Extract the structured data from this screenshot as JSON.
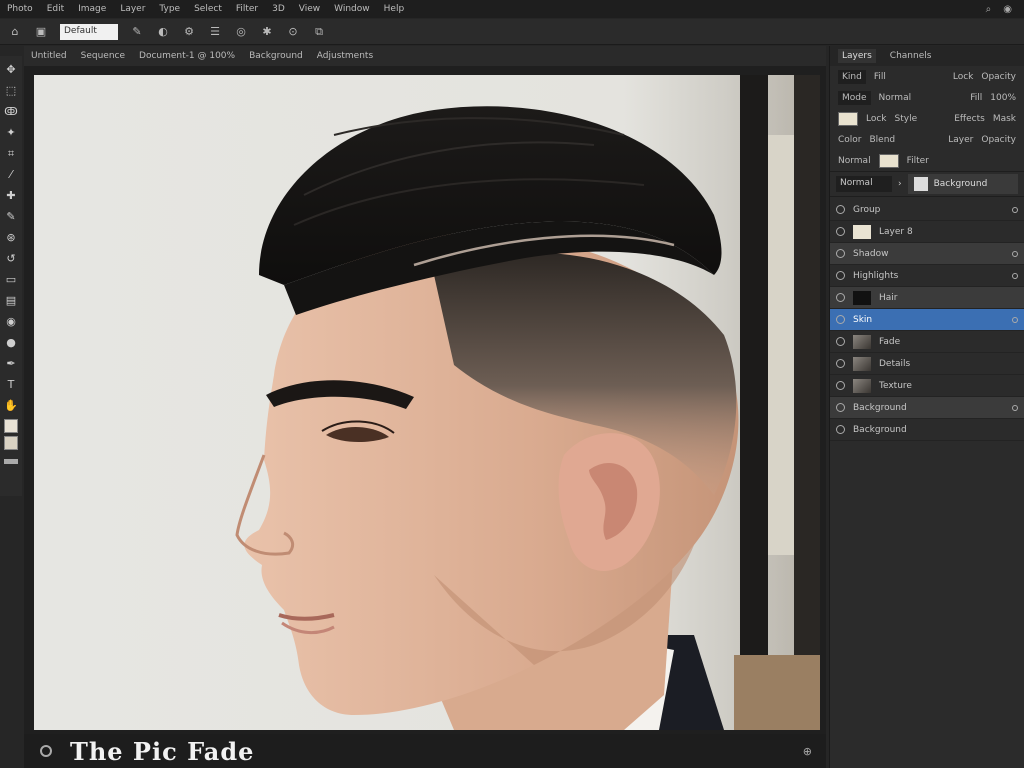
{
  "menubar": {
    "items": [
      "Photo",
      "Edit",
      "Image",
      "Layer",
      "Type",
      "Select",
      "Filter",
      "3D",
      "View",
      "Window",
      "Help"
    ]
  },
  "options": {
    "preset": "Default"
  },
  "tabs": [
    "Untitled",
    "Sequence",
    "Document-1 @ 100%",
    "Background",
    "Adjustments"
  ],
  "panels": {
    "tabs": [
      "Layers",
      "Channels"
    ],
    "rows": [
      [
        "Kind",
        "Fill",
        "Lock",
        "Opacity"
      ],
      [
        "Mode",
        "Normal",
        "Fill",
        "100%"
      ],
      [
        "Lock",
        "Style",
        "Effects",
        "Mask"
      ],
      [
        "Color",
        "Blend",
        "Layer",
        "Opacity"
      ],
      [
        "Normal",
        "Filter"
      ]
    ],
    "blend_mode": "Normal",
    "blend_layer": "Background"
  },
  "layers": [
    {
      "name": "Group",
      "thumb": "none",
      "state": "normal"
    },
    {
      "name": "Layer 8",
      "thumb": "light",
      "state": "normal"
    },
    {
      "name": "Shadow",
      "thumb": "none",
      "state": "highlight"
    },
    {
      "name": "Highlights",
      "thumb": "none",
      "state": "normal"
    },
    {
      "name": "Hair",
      "thumb": "dark",
      "state": "highlight"
    },
    {
      "name": "Skin",
      "thumb": "none",
      "state": "selected"
    },
    {
      "name": "Fade",
      "thumb": "photo",
      "state": "normal"
    },
    {
      "name": "Details",
      "thumb": "photo",
      "state": "normal"
    },
    {
      "name": "Texture",
      "thumb": "photo",
      "state": "normal"
    },
    {
      "name": "Background",
      "thumb": "none",
      "state": "highlight"
    },
    {
      "name": "Background",
      "thumb": "none",
      "state": "normal"
    }
  ],
  "status": {
    "title": "The Pic Fade",
    "zoom_icon": "zoom-icon"
  },
  "colors": {
    "selection": "#3b6fb3",
    "panel": "#2b2b2b",
    "canvas_bg": "#e8e7e3"
  }
}
